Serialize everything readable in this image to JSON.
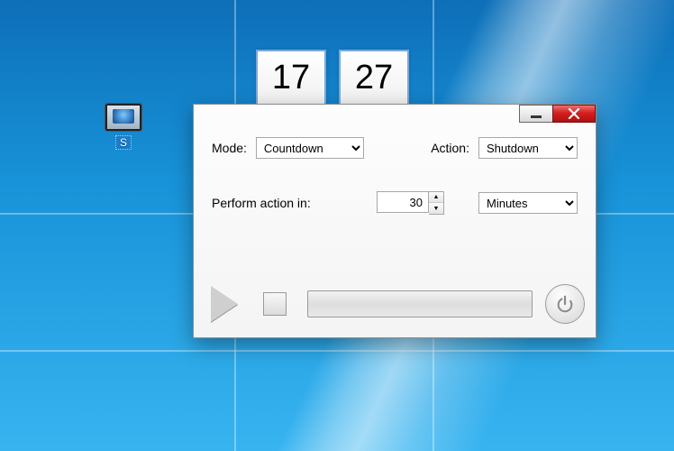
{
  "desktop": {
    "icon_label": "S"
  },
  "clock": {
    "hours": "17",
    "minutes": "27"
  },
  "form": {
    "mode_label": "Mode:",
    "mode_value": "Countdown",
    "action_label": "Action:",
    "action_value": "Shutdown",
    "perform_label": "Perform action in:",
    "amount": "30",
    "unit": "Minutes"
  },
  "icons": {
    "play": "play-icon",
    "stop": "stop-icon",
    "power": "power-icon",
    "minimize": "minimize-icon",
    "close": "close-icon"
  }
}
